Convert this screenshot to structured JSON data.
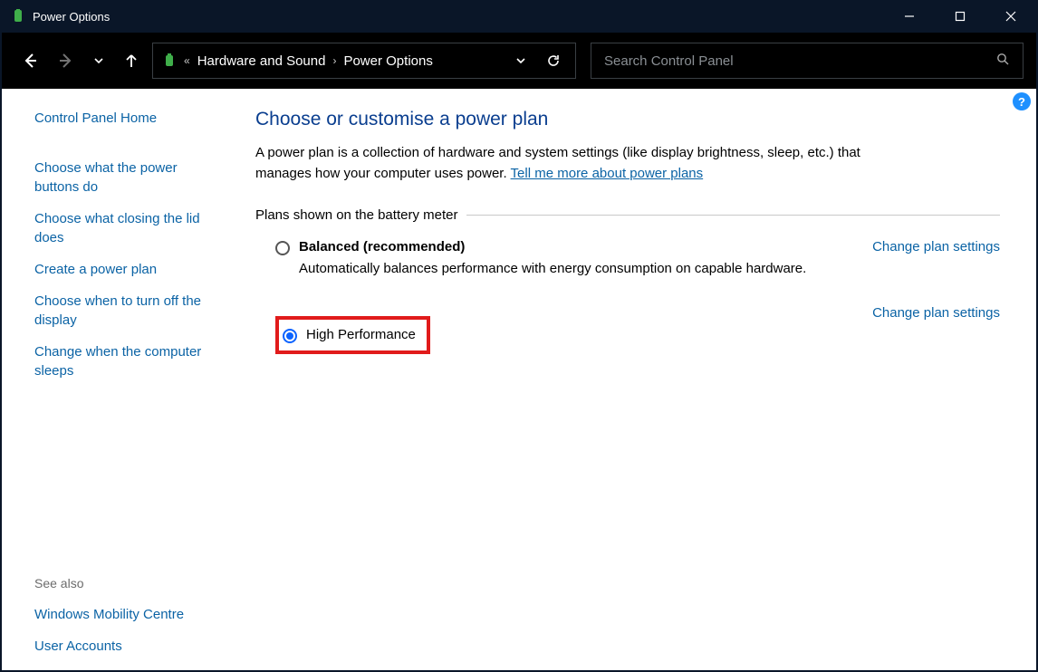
{
  "window": {
    "title": "Power Options"
  },
  "breadcrumb": {
    "level1": "Hardware and Sound",
    "level2": "Power Options"
  },
  "search": {
    "placeholder": "Search Control Panel"
  },
  "sidebar": {
    "home": "Control Panel Home",
    "links": [
      "Choose what the power buttons do",
      "Choose what closing the lid does",
      "Create a power plan",
      "Choose when to turn off the display",
      "Change when the computer sleeps"
    ],
    "see_also_label": "See also",
    "see_also": [
      "Windows Mobility Centre",
      "User Accounts"
    ]
  },
  "main": {
    "heading": "Choose or customise a power plan",
    "description_pre": "A power plan is a collection of hardware and system settings (like display brightness, sleep, etc.) that manages how your computer uses power. ",
    "description_link": "Tell me more about power plans",
    "plans_label": "Plans shown on the battery meter",
    "plans": [
      {
        "name": "Balanced (recommended)",
        "sub": "Automatically balances performance with energy consumption on capable hardware.",
        "selected": false,
        "change": "Change plan settings"
      },
      {
        "name": "High Performance",
        "sub": "",
        "selected": true,
        "change": "Change plan settings"
      }
    ]
  }
}
